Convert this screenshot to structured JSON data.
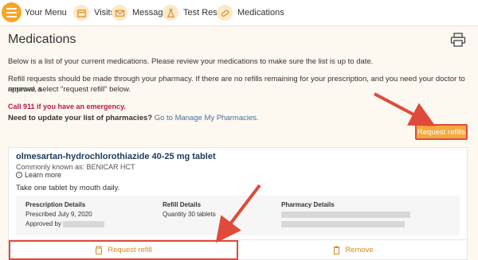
{
  "nav": {
    "menu_label": "Your Menu",
    "items": [
      {
        "label": "Visits",
        "icon": "calendar-icon"
      },
      {
        "label": "Messages",
        "icon": "envelope-icon"
      },
      {
        "label": "Test Results",
        "icon": "flask-icon"
      },
      {
        "label": "Medications",
        "icon": "pill-icon"
      }
    ]
  },
  "page": {
    "title": "Medications",
    "intro": "Below is a list of your current medications. Please review your medications to make sure the list is up to date.",
    "refill_info_1": "Refill requests should be made through your pharmacy. If there are no refills remaining for your prescription, and you need your doctor to approve a",
    "refill_info_2": "renewal, select \"request refill\" below.",
    "emergency": "Call 911 if you have an emergency.",
    "pharmacy_prompt": "Need to update your list of pharmacies?",
    "pharmacy_link": "Go to Manage My Pharmacies.",
    "request_refills_button": "Request refills"
  },
  "medication": {
    "name": "olmesartan-hydrochlorothiazide 40-25 mg tablet",
    "known_as": "Commonly known as: BENICAR HCT",
    "learn_more": "Learn more",
    "instructions": "Take one tablet by mouth daily.",
    "prescription_header": "Prescription Details",
    "prescribed": "Prescribed July 9, 2020",
    "approved_by": "Approved by",
    "refill_header": "Refill Details",
    "quantity": "Quantity 30 tablets",
    "pharmacy_header": "Pharmacy Details",
    "request_refill_button": "Request refill",
    "remove_button": "Remove"
  },
  "colors": {
    "accent": "#f3a93c",
    "annotation_red": "#e04a3a",
    "emergency": "#c0173c"
  }
}
